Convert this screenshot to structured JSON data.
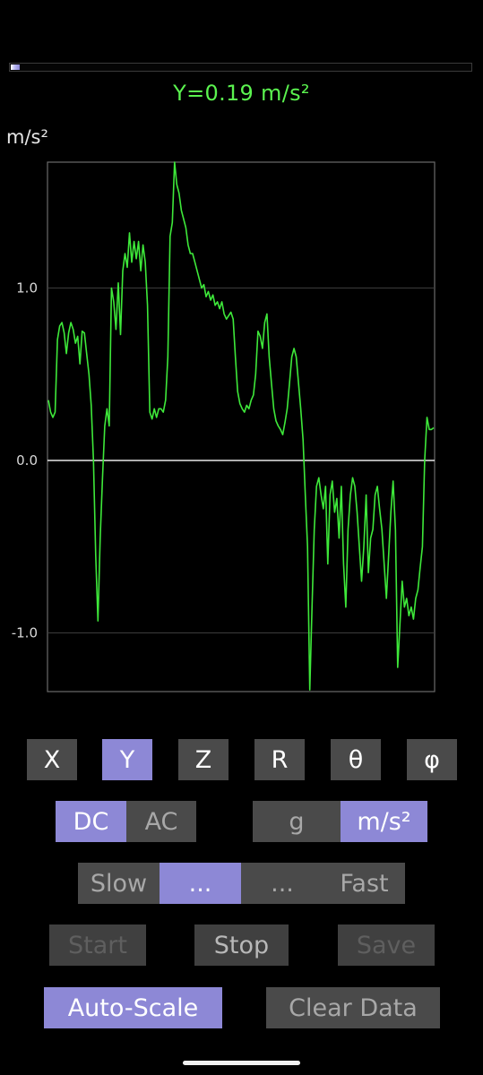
{
  "level_bar": {
    "fraction": 0.02
  },
  "readout": "Y=0.19 m/s²",
  "unit_label": "m/s²",
  "chart_data": {
    "type": "line",
    "title": "",
    "xlabel": "",
    "ylabel": "m/s²",
    "ylim": [
      -1.34,
      1.73
    ],
    "y_ticks": [
      "1.0",
      "0.0",
      "-1.0"
    ],
    "y_tick_values": [
      1.0,
      0.0,
      -1.0
    ],
    "grid": true,
    "series": [
      {
        "color": "#3ee83a",
        "values": [
          0.35,
          0.28,
          0.25,
          0.28,
          0.7,
          0.78,
          0.8,
          0.74,
          0.62,
          0.74,
          0.8,
          0.76,
          0.68,
          0.72,
          0.56,
          0.75,
          0.74,
          0.62,
          0.5,
          0.32,
          0.0,
          -0.55,
          -0.93,
          -0.45,
          -0.1,
          0.2,
          0.3,
          0.2,
          1.0,
          0.92,
          0.76,
          1.03,
          0.73,
          1.1,
          1.2,
          1.12,
          1.32,
          1.15,
          1.27,
          1.17,
          1.27,
          1.1,
          1.25,
          1.15,
          0.9,
          0.28,
          0.24,
          0.3,
          0.25,
          0.3,
          0.3,
          0.28,
          0.35,
          0.6,
          1.3,
          1.38,
          1.73,
          1.6,
          1.55,
          1.45,
          1.4,
          1.35,
          1.25,
          1.2,
          1.2,
          1.15,
          1.1,
          1.05,
          1.0,
          1.02,
          0.95,
          0.98,
          0.93,
          0.96,
          0.9,
          0.92,
          0.88,
          0.92,
          0.85,
          0.82,
          0.84,
          0.86,
          0.82,
          0.6,
          0.4,
          0.33,
          0.3,
          0.28,
          0.32,
          0.3,
          0.35,
          0.38,
          0.5,
          0.75,
          0.72,
          0.65,
          0.8,
          0.85,
          0.6,
          0.45,
          0.3,
          0.23,
          0.2,
          0.18,
          0.15,
          0.22,
          0.3,
          0.45,
          0.6,
          0.65,
          0.6,
          0.45,
          0.3,
          0.12,
          -0.2,
          -0.5,
          -1.33,
          -0.85,
          -0.4,
          -0.15,
          -0.1,
          -0.2,
          -0.28,
          -0.15,
          -0.6,
          -0.2,
          -0.12,
          -0.3,
          -0.22,
          -0.45,
          -0.15,
          -0.6,
          -0.85,
          -0.4,
          -0.2,
          -0.1,
          -0.15,
          -0.3,
          -0.5,
          -0.7,
          -0.5,
          -0.2,
          -0.65,
          -0.45,
          -0.4,
          -0.2,
          -0.15,
          -0.28,
          -0.4,
          -0.6,
          -0.8,
          -0.55,
          -0.3,
          -0.12,
          -0.4,
          -1.2,
          -0.95,
          -0.7,
          -0.85,
          -0.8,
          -0.9,
          -0.85,
          -0.92,
          -0.8,
          -0.75,
          -0.62,
          -0.5,
          0.0,
          0.25,
          0.18,
          0.18,
          0.19
        ]
      }
    ]
  },
  "axis_buttons": [
    {
      "label": "X",
      "selected": false
    },
    {
      "label": "Y",
      "selected": true
    },
    {
      "label": "Z",
      "selected": false
    },
    {
      "label": "R",
      "selected": false
    },
    {
      "label": "θ",
      "selected": false
    },
    {
      "label": "φ",
      "selected": false
    }
  ],
  "coupling": {
    "dc": {
      "label": "DC",
      "selected": true
    },
    "ac": {
      "label": "AC",
      "selected": false
    }
  },
  "units": {
    "g": {
      "label": "g",
      "selected": false
    },
    "ms2": {
      "label": "m/s²",
      "selected": true
    }
  },
  "speed": {
    "slow_label": "Slow",
    "mid1_label": "...",
    "mid2_label": "...",
    "fast_label": "Fast",
    "selected": "mid1"
  },
  "controls": {
    "start_label": "Start",
    "stop_label": "Stop",
    "save_label": "Save",
    "start_enabled": false,
    "stop_enabled": true,
    "save_enabled": false
  },
  "scale": {
    "auto_scale_label": "Auto-Scale",
    "clear_data_label": "Clear Data",
    "auto_scale_on": true
  },
  "colors": {
    "trace": "#3ee83a",
    "readout": "#5bf34f",
    "accent": "#8d88d6",
    "button": "#4a4a4a"
  }
}
